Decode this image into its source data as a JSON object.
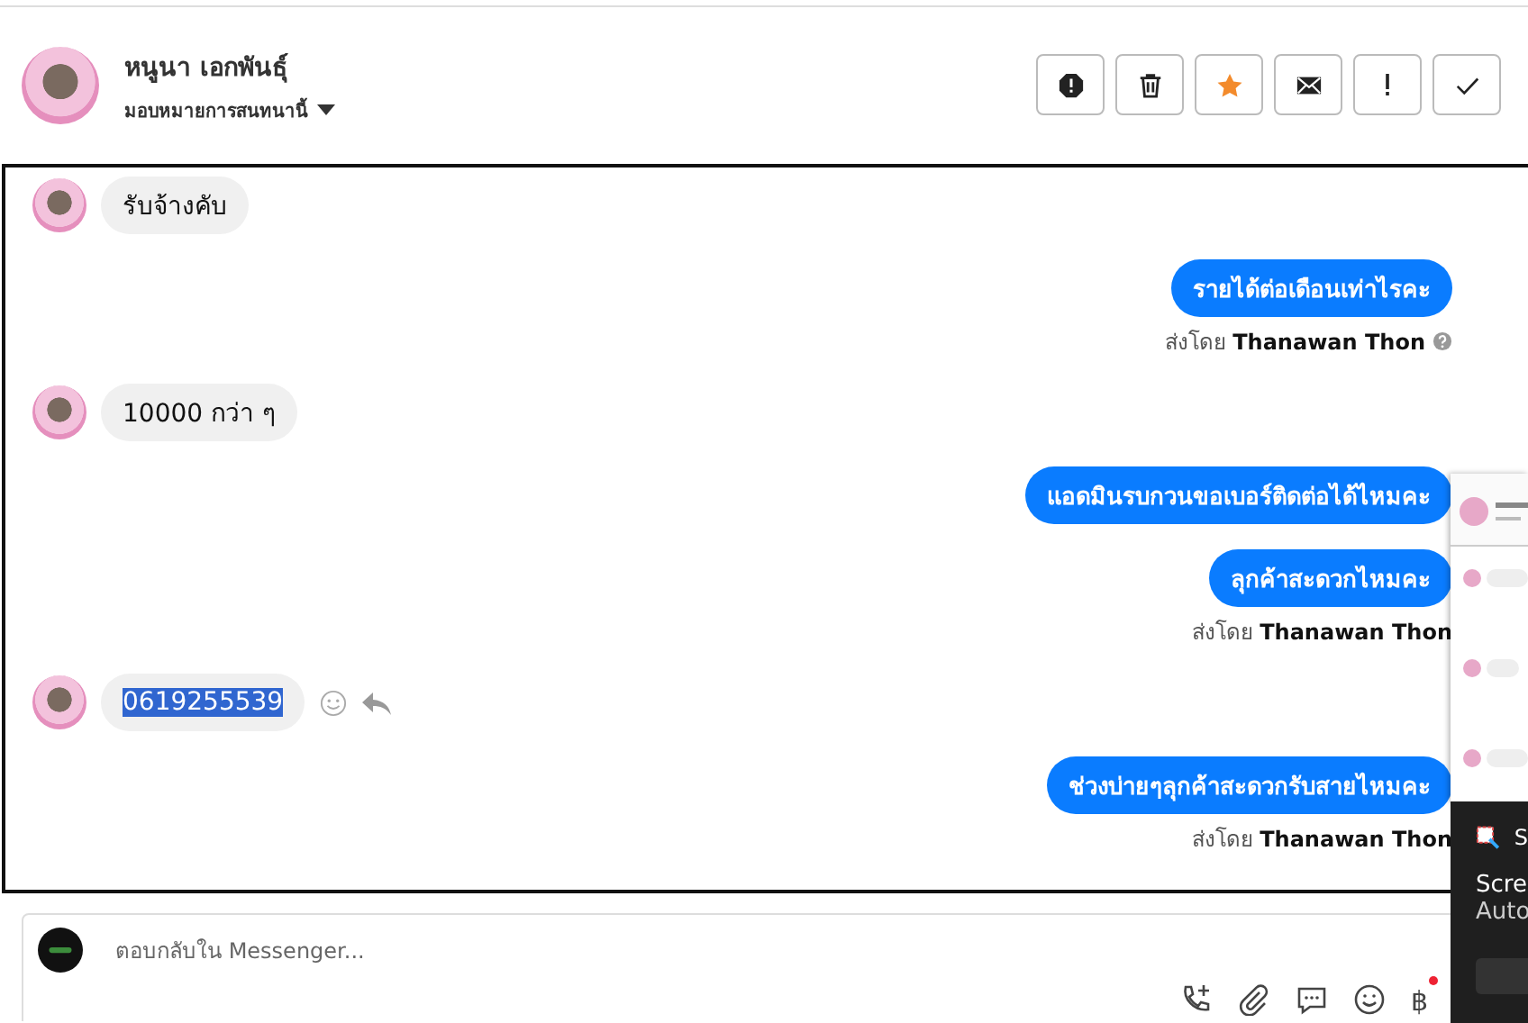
{
  "header": {
    "name": "หนูนา เอกพันธุ์",
    "assign": "มอบหมายการสนทนานี้"
  },
  "actions": [
    {
      "kind": "spam",
      "on": false
    },
    {
      "kind": "delete",
      "on": false
    },
    {
      "kind": "star",
      "on": true
    },
    {
      "kind": "unread",
      "on": false
    },
    {
      "kind": "important",
      "on": false
    },
    {
      "kind": "done",
      "on": false
    }
  ],
  "messages": [
    {
      "kind": "incoming",
      "text": "รับจ้างคับ",
      "selected": false,
      "show_actions": false
    },
    {
      "kind": "outgoing",
      "text": "รายได้ต่อเดือนเท่าไรคะ",
      "sent_by_label": "ส่งโดย",
      "sender": "Thanawan Thon",
      "help": true
    },
    {
      "kind": "incoming",
      "text": "10000  กว่า ๆ",
      "selected": false,
      "show_actions": false
    },
    {
      "kind": "outgoing",
      "text": "แอดมินรบกวนขอเบอร์ติดต่อได้ไหมคะ"
    },
    {
      "kind": "outgoing",
      "text": "ลุกค้าสะดวกไหมคะ",
      "sent_by_label": "ส่งโดย",
      "sender": "Thanawan Thon",
      "help": false
    },
    {
      "kind": "incoming",
      "text": "0619255539",
      "selected": true,
      "show_actions": true
    },
    {
      "kind": "outgoing",
      "text": "ช่วงบ่ายๆลุกค้าสะดวกรับสายไหมคะ",
      "sent_by_label": "ส่งโดย",
      "sender": "Thanawan Thon",
      "help": false
    }
  ],
  "composer": {
    "placeholder": "ตอบกลับใน Messenger...",
    "currency": "฿"
  },
  "notification": {
    "app": "S",
    "title": "Scre",
    "body": "Auto"
  }
}
